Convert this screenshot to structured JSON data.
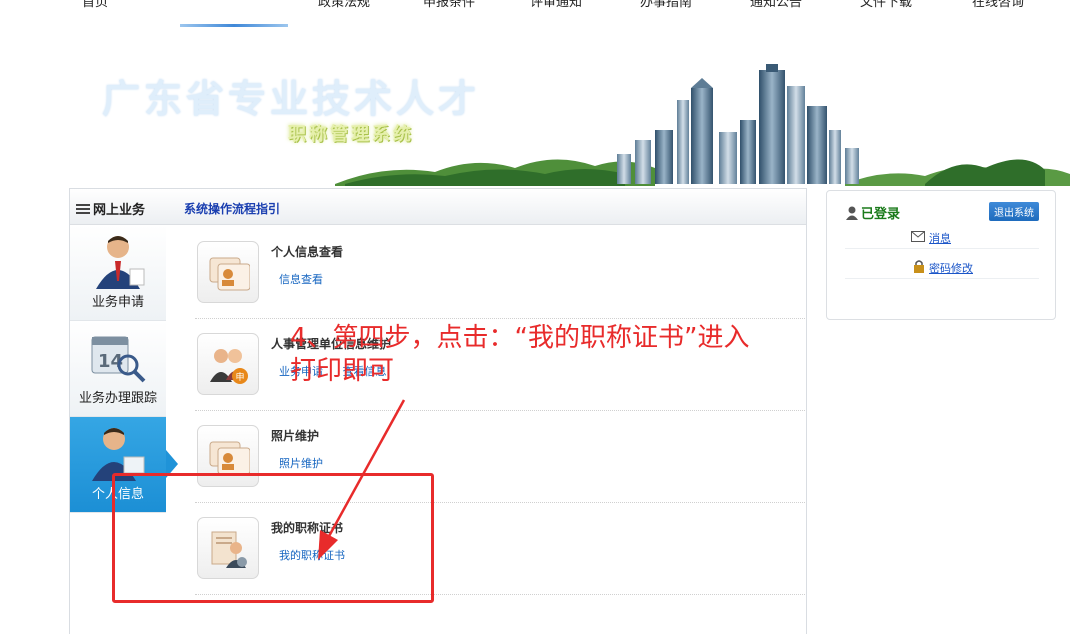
{
  "topnav": {
    "items": [
      "首页",
      "政策法规",
      "申报条件",
      "评审通知",
      "办事指南",
      "通知公告",
      "文件下载",
      "在线咨询"
    ]
  },
  "banner": {
    "title": "广东省专业技术人才",
    "subtitle": "职称管理系统"
  },
  "panel": {
    "title": "网上业务",
    "guide_link": "系统操作流程指引"
  },
  "sidebar": {
    "items": [
      {
        "label": "业务申请"
      },
      {
        "label": "业务办理跟踪"
      },
      {
        "label": "个人信息"
      }
    ]
  },
  "entries": [
    {
      "title": "个人信息查看",
      "links": [
        "信息查看"
      ]
    },
    {
      "title": "人事管理单位信息维护",
      "links": [
        "业务申请",
        "查看信息"
      ]
    },
    {
      "title": "照片维护",
      "links": [
        "照片维护"
      ]
    },
    {
      "title": "我的职称证书",
      "links": [
        "我的职称证书"
      ]
    }
  ],
  "login": {
    "status": "已登录",
    "logout": "退出系统",
    "messages": "消息",
    "password": "密码修改"
  },
  "annotation": {
    "line1": "4、第四步，点击：“我的职称证书”进入",
    "line2": "打印即可",
    "color": "#e82b2b"
  }
}
